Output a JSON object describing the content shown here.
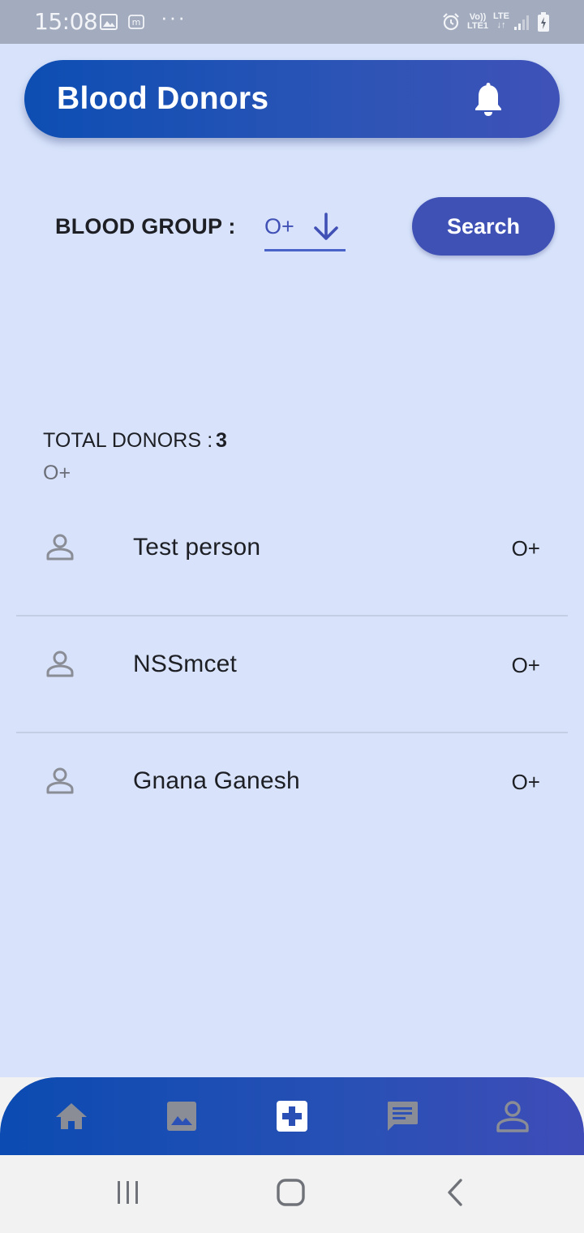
{
  "status_bar": {
    "time": "15:08",
    "more": "···",
    "volte": "Vo)) LTE1",
    "lte": "LTE",
    "icons": [
      "gallery-icon",
      "m-app-icon",
      "alarm-icon",
      "volte-icon",
      "lte-icon",
      "signal-icon",
      "battery-charging-icon"
    ]
  },
  "header": {
    "title": "Blood Donors",
    "icon": "bell-icon"
  },
  "filter": {
    "label": "BLOOD GROUP :",
    "selected": "O+",
    "dropdown_icon": "arrow-down-icon",
    "search_label": "Search"
  },
  "totals": {
    "label": "TOTAL DONORS :",
    "count": "3",
    "group": "O+"
  },
  "donors": [
    {
      "name": "Test person",
      "group": "O+"
    },
    {
      "name": "NSSmcet",
      "group": "O+"
    },
    {
      "name": "Gnana Ganesh",
      "group": "O+"
    }
  ],
  "bottom_nav": {
    "items": [
      "home-icon",
      "image-icon",
      "medical-cross-icon",
      "chat-icon",
      "person-icon"
    ],
    "active": "medical-cross-icon"
  },
  "system_nav": {
    "items": [
      "recent-apps-icon",
      "home-button-icon",
      "back-icon"
    ]
  },
  "colors": {
    "background": "#d8e3fb",
    "header_gradient_start": "#0d4eb3",
    "header_gradient_end": "#3f52b8",
    "accent": "#3f51b5",
    "icon_gray": "#8a8d96"
  }
}
